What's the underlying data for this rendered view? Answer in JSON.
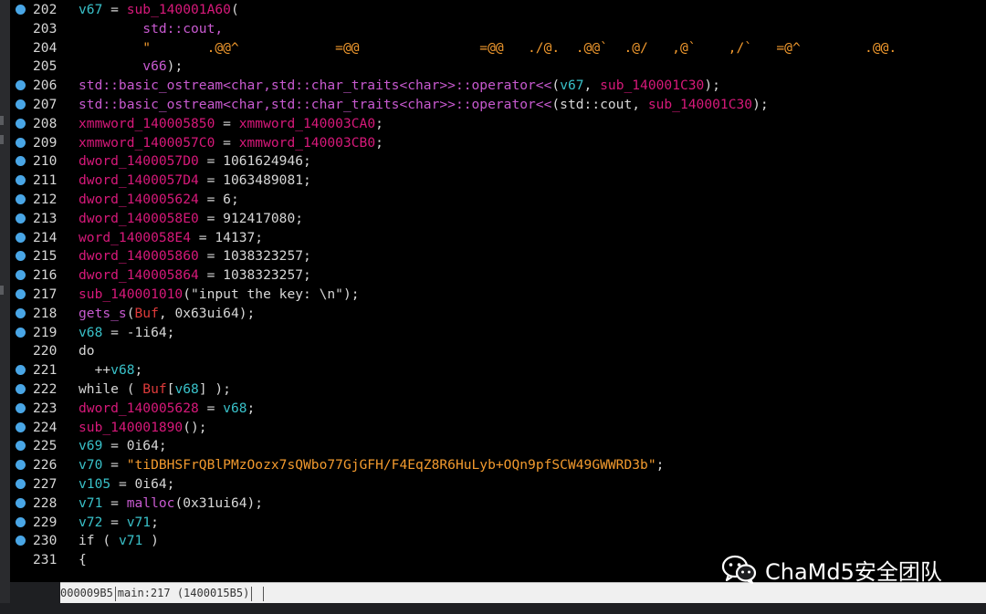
{
  "editor": {
    "lines": [
      {
        "num": "202",
        "bp": true,
        "tokens": [
          [
            "v67",
            "var"
          ],
          [
            " = ",
            "def"
          ],
          [
            "sub_140001A60",
            "fn"
          ],
          [
            "(",
            "def"
          ]
        ]
      },
      {
        "num": "203",
        "bp": false,
        "tokens": [
          [
            "        std::cout,",
            "type"
          ]
        ]
      },
      {
        "num": "204",
        "bp": false,
        "tokens": [
          [
            "        \"       .@@^            =@@               =@@   ./@.  .@@`  .@/   ,@`    ,/`   =@^        .@@.",
            "str"
          ]
        ]
      },
      {
        "num": "205",
        "bp": false,
        "tokens": [
          [
            "        v66",
            "type"
          ],
          [
            ");",
            "def"
          ]
        ]
      },
      {
        "num": "206",
        "bp": true,
        "tokens": [
          [
            "std::basic_ostream<char,std::char_traits<char>>::operator<<",
            "type"
          ],
          [
            "(",
            "def"
          ],
          [
            "v67",
            "var"
          ],
          [
            ", ",
            "def"
          ],
          [
            "sub_140001C30",
            "glob"
          ],
          [
            ");",
            "def"
          ]
        ]
      },
      {
        "num": "207",
        "bp": true,
        "tokens": [
          [
            "std::basic_ostream<char,std::char_traits<char>>::operator<<",
            "type"
          ],
          [
            "(std::cout, ",
            "def"
          ],
          [
            "sub_140001C30",
            "glob"
          ],
          [
            ");",
            "def"
          ]
        ]
      },
      {
        "num": "208",
        "bp": true,
        "tokens": [
          [
            "xmmword_140005850",
            "glob"
          ],
          [
            " = ",
            "def"
          ],
          [
            "xmmword_140003CA0",
            "glob"
          ],
          [
            ";",
            "def"
          ]
        ]
      },
      {
        "num": "209",
        "bp": true,
        "tokens": [
          [
            "xmmword_1400057C0",
            "glob"
          ],
          [
            " = ",
            "def"
          ],
          [
            "xmmword_140003CB0",
            "glob"
          ],
          [
            ";",
            "def"
          ]
        ]
      },
      {
        "num": "210",
        "bp": true,
        "tokens": [
          [
            "dword_1400057D0",
            "glob"
          ],
          [
            " = 1061624946;",
            "def"
          ]
        ]
      },
      {
        "num": "211",
        "bp": true,
        "tokens": [
          [
            "dword_1400057D4",
            "glob"
          ],
          [
            " = 1063489081;",
            "def"
          ]
        ]
      },
      {
        "num": "212",
        "bp": true,
        "tokens": [
          [
            "dword_140005624",
            "glob"
          ],
          [
            " = 6;",
            "def"
          ]
        ]
      },
      {
        "num": "213",
        "bp": true,
        "tokens": [
          [
            "dword_1400058E0",
            "glob"
          ],
          [
            " = 912417080;",
            "def"
          ]
        ]
      },
      {
        "num": "214",
        "bp": true,
        "tokens": [
          [
            "word_1400058E4",
            "glob"
          ],
          [
            " = 14137;",
            "def"
          ]
        ]
      },
      {
        "num": "215",
        "bp": true,
        "tokens": [
          [
            "dword_140005860",
            "glob"
          ],
          [
            " = 1038323257;",
            "def"
          ]
        ]
      },
      {
        "num": "216",
        "bp": true,
        "tokens": [
          [
            "dword_140005864",
            "glob"
          ],
          [
            " = 1038323257;",
            "def"
          ]
        ]
      },
      {
        "num": "217",
        "bp": true,
        "tokens": [
          [
            "sub_140001010",
            "glob"
          ],
          [
            "(\"input the key: \\n\");",
            "def"
          ]
        ]
      },
      {
        "num": "218",
        "bp": true,
        "tokens": [
          [
            "gets_s",
            "type"
          ],
          [
            "(",
            "def"
          ],
          [
            "Buf",
            "local"
          ],
          [
            ", 0x63ui64);",
            "def"
          ]
        ]
      },
      {
        "num": "219",
        "bp": true,
        "tokens": [
          [
            "v68",
            "var"
          ],
          [
            " = -1i64;",
            "def"
          ]
        ]
      },
      {
        "num": "220",
        "bp": false,
        "tokens": [
          [
            "do",
            "def"
          ]
        ]
      },
      {
        "num": "221",
        "bp": true,
        "tokens": [
          [
            "  ++",
            "def"
          ],
          [
            "v68",
            "var"
          ],
          [
            ";",
            "def"
          ]
        ]
      },
      {
        "num": "222",
        "bp": true,
        "tokens": [
          [
            "while ( ",
            "def"
          ],
          [
            "Buf",
            "local"
          ],
          [
            "[",
            "def"
          ],
          [
            "v68",
            "var"
          ],
          [
            "] );",
            "def"
          ]
        ]
      },
      {
        "num": "223",
        "bp": true,
        "tokens": [
          [
            "dword_140005628",
            "glob"
          ],
          [
            " = ",
            "def"
          ],
          [
            "v68",
            "var"
          ],
          [
            ";",
            "def"
          ]
        ]
      },
      {
        "num": "224",
        "bp": true,
        "tokens": [
          [
            "sub_140001890",
            "glob"
          ],
          [
            "();",
            "def"
          ]
        ]
      },
      {
        "num": "225",
        "bp": true,
        "tokens": [
          [
            "v69",
            "var"
          ],
          [
            " = 0i64;",
            "def"
          ]
        ]
      },
      {
        "num": "226",
        "bp": true,
        "tokens": [
          [
            "v70",
            "var"
          ],
          [
            " = ",
            "def"
          ],
          [
            "\"tiDBHSFrQBlPMzOozx7sQWbo77GjGFH/F4EqZ8R6HuLyb+OQn9pfSCW49GWWRD3b\"",
            "str"
          ],
          [
            ";",
            "def"
          ]
        ]
      },
      {
        "num": "227",
        "bp": true,
        "tokens": [
          [
            "v105",
            "var"
          ],
          [
            " = 0i64;",
            "def"
          ]
        ]
      },
      {
        "num": "228",
        "bp": true,
        "tokens": [
          [
            "v71",
            "var"
          ],
          [
            " = ",
            "def"
          ],
          [
            "malloc",
            "type"
          ],
          [
            "(0x31ui64);",
            "def"
          ]
        ]
      },
      {
        "num": "229",
        "bp": true,
        "tokens": [
          [
            "v72",
            "var"
          ],
          [
            " = ",
            "def"
          ],
          [
            "v71",
            "var"
          ],
          [
            ";",
            "def"
          ]
        ]
      },
      {
        "num": "230",
        "bp": true,
        "tokens": [
          [
            "if ( ",
            "def"
          ],
          [
            "v71",
            "var"
          ],
          [
            " )",
            "def"
          ]
        ]
      },
      {
        "num": "231",
        "bp": false,
        "tokens": [
          [
            "{",
            "def"
          ]
        ]
      }
    ]
  },
  "status_bar": {
    "offset": "000009B5",
    "location": "main:217 (1400015B5)"
  },
  "watermark": {
    "text": "ChaMd5安全团队",
    "icon": "wechat-icon"
  }
}
